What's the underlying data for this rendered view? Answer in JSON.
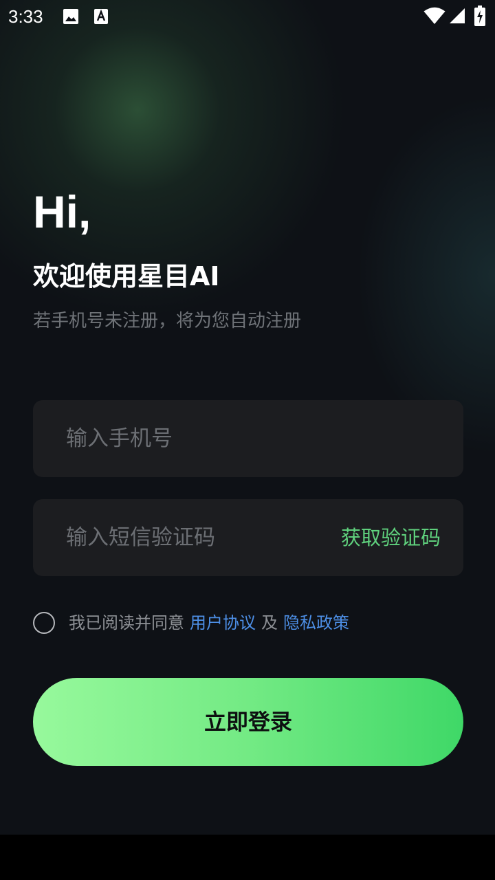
{
  "status_bar": {
    "time": "3:33",
    "icons": [
      "image-icon",
      "font-download-icon",
      "wifi-icon",
      "cell-signal-icon",
      "battery-charging-icon"
    ]
  },
  "greeting": {
    "hi": "Hi,",
    "welcome": "欢迎使用星目AI",
    "subtitle": "若手机号未注册，将为您自动注册"
  },
  "form": {
    "phone_placeholder": "输入手机号",
    "code_placeholder": "输入短信验证码",
    "get_code_label": "获取验证码"
  },
  "agreement": {
    "checked": false,
    "prefix": "我已阅读并同意",
    "user_agreement": "用户协议",
    "and": "及",
    "privacy_policy": "隐私政策"
  },
  "login": {
    "label": "立即登录"
  },
  "colors": {
    "accent_green": "#5fd17d",
    "link_blue": "#4d8fe6",
    "background": "#0e1116",
    "input_bg": "#1c1d20"
  }
}
